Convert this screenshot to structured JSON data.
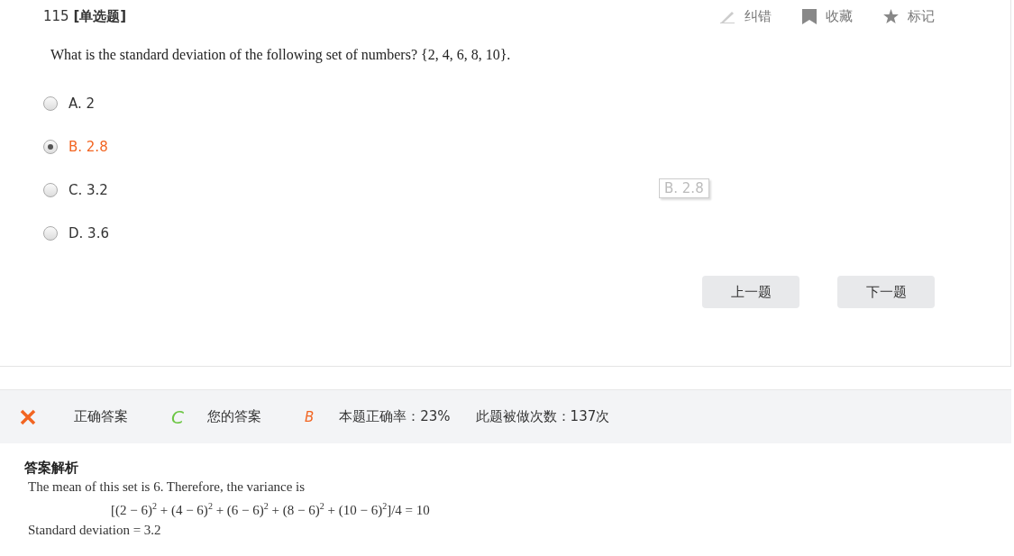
{
  "question": {
    "header": "115 **[单选题]**",
    "text": "What is the standard deviation of the following set of numbers?  {2, 4, 6, 8, 10}.",
    "tools": [
      {
        "kind": "pencil",
        "label": "纠错"
      },
      {
        "kind": "bookmark",
        "label": "收藏"
      },
      {
        "kind": "star",
        "label": "标记"
      }
    ],
    "options": [
      {
        "label": "A. 2",
        "selected": false
      },
      {
        "label": "B. 2.8",
        "selected": true
      },
      {
        "label": "C. 3.2",
        "selected": false
      },
      {
        "label": "D. 3.6",
        "selected": false
      }
    ],
    "tooltip": "B. 2.8",
    "buttons": [
      "上一题",
      "下一题"
    ]
  },
  "result": {
    "correct": false,
    "correct_label": "正确答案",
    "correct_answer": "C",
    "your_label": "您的答案",
    "your_answer": "B",
    "accuracy": "本题正确率：23%",
    "attempts": "此题被做次数：137次"
  },
  "explanation": {
    "title": "答案解析",
    "intro": "The mean of this set is 6. Therefore, the variance is",
    "formula": "[(2 − 6)$^{2}$ + (4 − 6)$^{2}$ + (6 − 6)$^{2}$ + (8 − 6)$^{2}$ + (10 − 6)$^{2}$]/4 = 10",
    "conclusion": "Standard deviation = 3.2"
  }
}
